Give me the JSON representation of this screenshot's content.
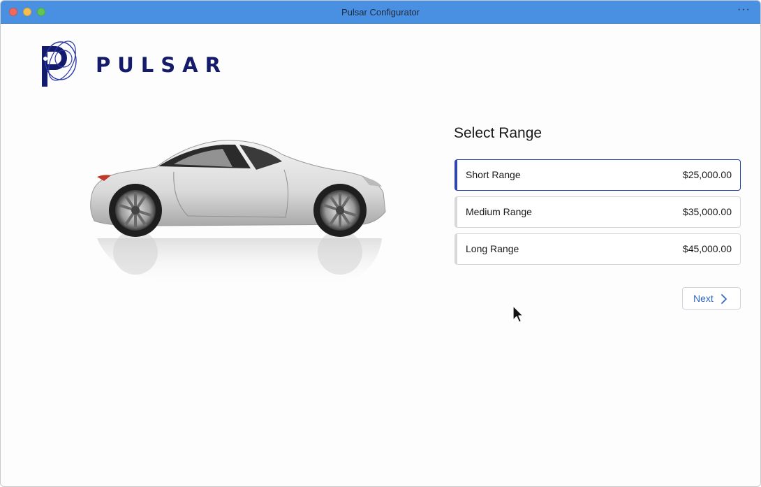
{
  "window": {
    "title": "Pulsar Configurator",
    "more_menu": "···"
  },
  "brand": {
    "name": "PULSAR",
    "color": "#141b6b"
  },
  "selector": {
    "title": "Select Range",
    "options": [
      {
        "name": "Short Range",
        "price": "$25,000.00",
        "selected": true
      },
      {
        "name": "Medium Range",
        "price": "$35,000.00",
        "selected": false
      },
      {
        "name": "Long Range",
        "price": "$45,000.00",
        "selected": false
      }
    ],
    "accent": "#2a46b8"
  },
  "actions": {
    "next_label": "Next"
  },
  "icons": {
    "next": "chevron-right-icon",
    "cursor": "mouse-pointer-icon"
  }
}
